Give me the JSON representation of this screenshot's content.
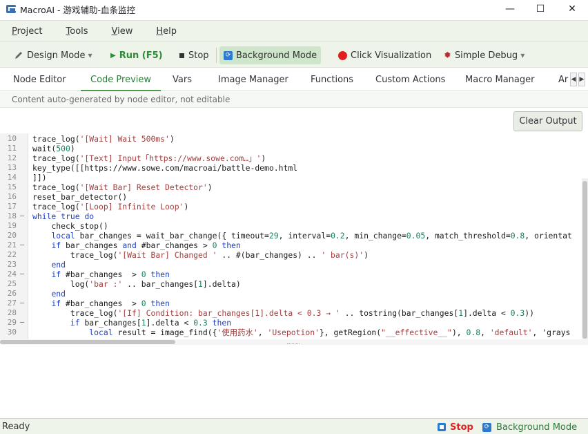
{
  "window": {
    "title": "MacroAI - 游戏辅助-血条监控",
    "controls": {
      "minimize": "—",
      "maximize": "☐",
      "close": "✕"
    }
  },
  "menu": [
    {
      "label": "Project",
      "mnemonic": "P",
      "rest": "roject"
    },
    {
      "label": "Tools",
      "mnemonic": "T",
      "rest": "ools"
    },
    {
      "label": "View",
      "mnemonic": "V",
      "rest": "iew"
    },
    {
      "label": "Help",
      "mnemonic": "H",
      "rest": "elp"
    }
  ],
  "toolbar": {
    "design_mode": "Design Mode",
    "run": "Run (F5)",
    "stop": "Stop",
    "background_mode": "Background Mode",
    "click_visualization": "Click Visualization",
    "simple_debug": "Simple Debug"
  },
  "tabs": [
    "Node Editor",
    "Code Preview",
    "Vars",
    "Image Manager",
    "Functions",
    "Custom Actions",
    "Macro Manager",
    "Ar"
  ],
  "active_tab": "Code Preview",
  "info_text": "Content auto-generated by node editor, not editable",
  "clear_output": "Clear Output",
  "code_lines": [
    {
      "n": "10",
      "text": "trace_log('[Wait] Wait 500ms')"
    },
    {
      "n": "11",
      "text": "wait(500)"
    },
    {
      "n": "12",
      "text": "trace_log('[Text] Input「https://www.sowe.com…」')"
    },
    {
      "n": "13",
      "text": "key_type([[https://www.sowe.com/macroai/battle-demo.html"
    },
    {
      "n": "14",
      "text": "]])"
    },
    {
      "n": "15",
      "text": "trace_log('[Wait Bar] Reset Detector')"
    },
    {
      "n": "16",
      "text": "reset_bar_detector()"
    },
    {
      "n": "17",
      "text": "trace_log('[Loop] Infinite Loop')"
    },
    {
      "n": "18",
      "text": "while true do",
      "fold": "–"
    },
    {
      "n": "19",
      "text": "    check_stop()"
    },
    {
      "n": "20",
      "text": "    local bar_changes = wait_bar_change({ timeout=29, interval=0.2, min_change=0.05, match_threshold=0.8, orientat"
    },
    {
      "n": "21",
      "text": "    if bar_changes and #bar_changes > 0 then",
      "fold": "–"
    },
    {
      "n": "22",
      "text": "        trace_log('[Wait Bar] Changed ' .. #(bar_changes) .. ' bar(s)')"
    },
    {
      "n": "23",
      "text": "    end"
    },
    {
      "n": "24",
      "text": "    if #bar_changes  > 0 then",
      "fold": "–"
    },
    {
      "n": "25",
      "text": "        log('bar :' .. bar_changes[1].delta)"
    },
    {
      "n": "26",
      "text": "    end"
    },
    {
      "n": "27",
      "text": "    if #bar_changes  > 0 then",
      "fold": "–"
    },
    {
      "n": "28",
      "text": "        trace_log('[If] Condition: bar_changes[1].delta < 0.3 → ' .. tostring(bar_changes[1].delta < 0.3))"
    },
    {
      "n": "29",
      "text": "        if bar_changes[1].delta < 0.3 then",
      "fold": "–"
    },
    {
      "n": "30",
      "text": "            local result = image_find({'使用药水', 'Usepotion'}, getRegion(\"__effective__\"), 0.8, 'default', 'grays"
    }
  ],
  "status": {
    "ready": "Ready",
    "stop": "Stop",
    "background_mode": "Background Mode"
  },
  "colors": {
    "accent_green": "#2e8b37",
    "stop_red": "#e02020",
    "status_blue": "#2a7ad4"
  }
}
